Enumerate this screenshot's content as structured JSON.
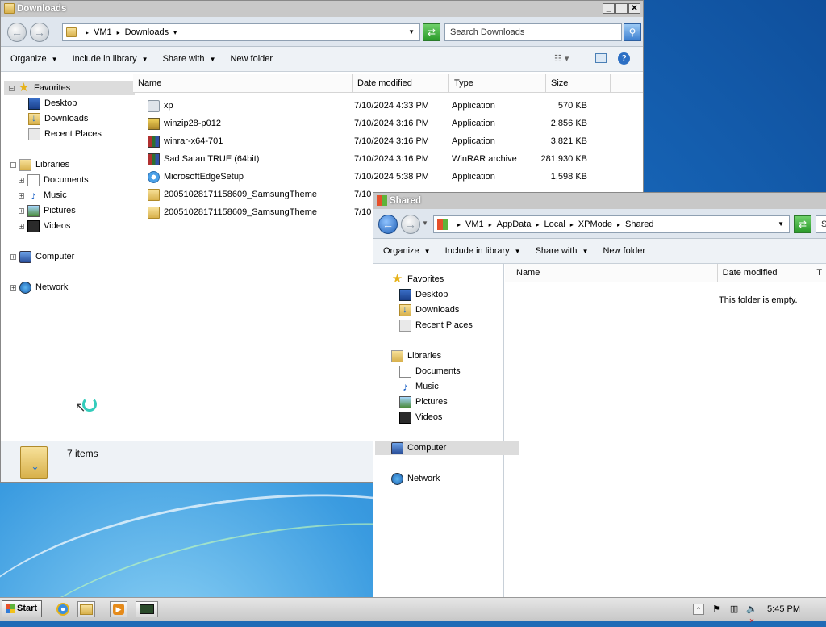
{
  "win1": {
    "title": "Downloads",
    "path": [
      "VM1",
      "Downloads"
    ],
    "search_placeholder": "Search Downloads",
    "cmd": [
      "Organize",
      "Include in library",
      "Share with",
      "New folder"
    ],
    "nav": {
      "favorites": "Favorites",
      "fav_items": [
        "Desktop",
        "Downloads",
        "Recent Places"
      ],
      "libraries": "Libraries",
      "lib_items": [
        "Documents",
        "Music",
        "Pictures",
        "Videos"
      ],
      "computer": "Computer",
      "network": "Network"
    },
    "columns": [
      "Name",
      "Date modified",
      "Type",
      "Size"
    ],
    "files": [
      {
        "name": "xp",
        "date": "7/10/2024 4:33 PM",
        "type": "Application",
        "size": "570 KB",
        "icon": "app-icon"
      },
      {
        "name": "winzip28-p012",
        "date": "7/10/2024 3:16 PM",
        "type": "Application",
        "size": "2,856 KB",
        "icon": "winzip-icon"
      },
      {
        "name": "winrar-x64-701",
        "date": "7/10/2024 3:16 PM",
        "type": "Application",
        "size": "3,821 KB",
        "icon": "winrar-icon"
      },
      {
        "name": "Sad Satan TRUE (64bit)",
        "date": "7/10/2024 3:16 PM",
        "type": "WinRAR archive",
        "size": "281,930 KB",
        "icon": "rar-archive-icon"
      },
      {
        "name": "MicrosoftEdgeSetup",
        "date": "7/10/2024 5:38 PM",
        "type": "Application",
        "size": "1,598 KB",
        "icon": "edge-setup-icon"
      },
      {
        "name": "20051028171158609_SamsungTheme",
        "date": "7/10",
        "type": "",
        "size": "",
        "icon": "folder-icon"
      },
      {
        "name": "20051028171158609_SamsungTheme",
        "date": "7/10",
        "type": "",
        "size": "",
        "icon": "folder-icon"
      }
    ],
    "status": "7 items"
  },
  "win2": {
    "title": "Shared",
    "path": [
      "VM1",
      "AppData",
      "Local",
      "XPMode",
      "Shared"
    ],
    "search_partial": "S",
    "cmd": [
      "Organize",
      "Include in library",
      "Share with",
      "New folder"
    ],
    "nav": {
      "favorites": "Favorites",
      "fav_items": [
        "Desktop",
        "Downloads",
        "Recent Places"
      ],
      "libraries": "Libraries",
      "lib_items": [
        "Documents",
        "Music",
        "Pictures",
        "Videos"
      ],
      "computer": "Computer",
      "network": "Network"
    },
    "columns": [
      "Name",
      "Date modified",
      "T"
    ],
    "empty": "This folder is empty."
  },
  "taskbar": {
    "start": "Start",
    "clock": "5:45 PM"
  },
  "colors": {
    "accent": "#1f5fb6",
    "titlebar": "#c8c8c8"
  }
}
